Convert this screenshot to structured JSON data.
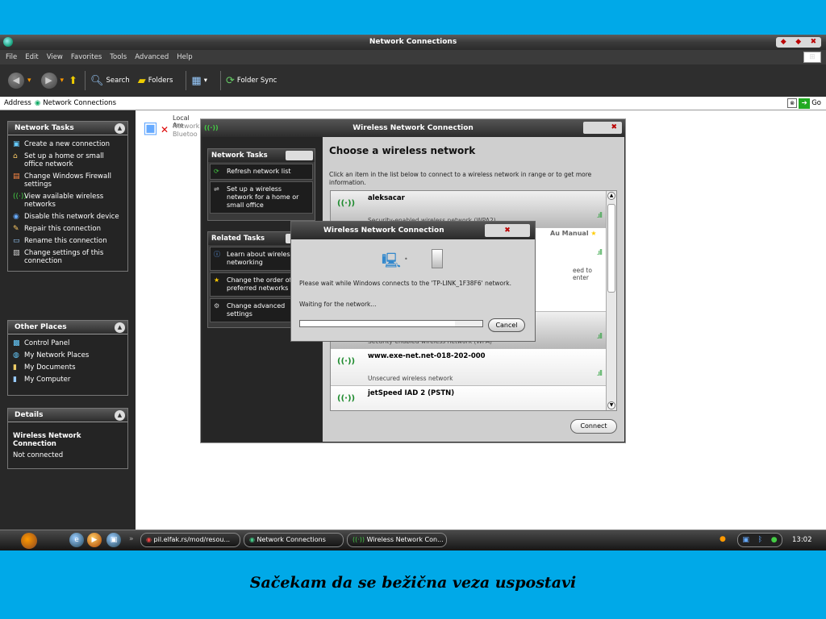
{
  "window": {
    "title": "Network Connections",
    "controls": [
      "◆",
      "◆",
      "✖"
    ]
  },
  "menu": [
    "File",
    "Edit",
    "View",
    "Favorites",
    "Tools",
    "Advanced",
    "Help"
  ],
  "toolbar": {
    "back": "Back",
    "forward": "Forward",
    "search": "Search",
    "folders": "Folders",
    "folder_sync": "Folder Sync"
  },
  "address": {
    "label": "Address",
    "value": "Network Connections",
    "go": "Go"
  },
  "left_pane": {
    "network_tasks": {
      "title": "Network Tasks",
      "items": [
        {
          "label": "Create a new connection",
          "icon": "new-connection-icon"
        },
        {
          "label": "Set up a home or small office network",
          "icon": "home-network-icon"
        },
        {
          "label": "Change Windows Firewall settings",
          "icon": "firewall-icon"
        },
        {
          "label": "View available wireless networks",
          "icon": "wireless-icon"
        },
        {
          "label": "Disable this network device",
          "icon": "disable-icon"
        },
        {
          "label": "Repair this connection",
          "icon": "repair-icon"
        },
        {
          "label": "Rename this connection",
          "icon": "rename-icon"
        },
        {
          "label": "Change settings of this connection",
          "icon": "settings-icon"
        }
      ]
    },
    "other_places": {
      "title": "Other Places",
      "items": [
        {
          "label": "Control Panel"
        },
        {
          "label": "My Network Places"
        },
        {
          "label": "My Documents"
        },
        {
          "label": "My Computer"
        }
      ]
    },
    "details": {
      "title": "Details",
      "name": "Wireless Network Connection",
      "status": "Not connected"
    }
  },
  "content": {
    "local_area": "Local Are",
    "network": "Network",
    "bluetooth": "Bluetoo"
  },
  "wireless_window": {
    "title": "Wireless Network Connection",
    "network_tasks_title": "Network Tasks",
    "network_tasks": [
      "Refresh network list",
      "Set up a wireless network for a home or small office"
    ],
    "related_tasks_title": "Related Tasks",
    "related_tasks": [
      "Learn about wireless networking",
      "Change the order of preferred networks",
      "Change advanced settings"
    ],
    "heading": "Choose a wireless network",
    "description": "Click an item in the list below to connect to a wireless network in range or to get more information.",
    "networks": [
      {
        "name": "aleksacar",
        "desc": "Security-enabled wireless network (WPA2)"
      },
      {
        "name": "",
        "desc": "eed to enter"
      },
      {
        "name": "",
        "desc": "Security-enabled wireless network (WPA)"
      },
      {
        "name": "www.exe-net.net-018-202-000",
        "desc": "Unsecured wireless network"
      },
      {
        "name": "jetSpeed IAD 2 (PSTN)",
        "desc": ""
      }
    ],
    "auto_manual": "Au Manual",
    "connect": "Connect"
  },
  "connect_dialog": {
    "title": "Wireless Network Connection",
    "message": "Please wait while Windows connects to the 'TP-LINK_1F38F6' network.",
    "waiting": "Waiting for the network...",
    "cancel": "Cancel",
    "progress": 0.0
  },
  "taskbar": {
    "tasks": [
      "pil.elfak.rs/mod/resou...",
      "Network Connections",
      "Wireless Network Con..."
    ],
    "clock": "13:02"
  },
  "caption": "Sačekam da se bežična veza uspostavi"
}
